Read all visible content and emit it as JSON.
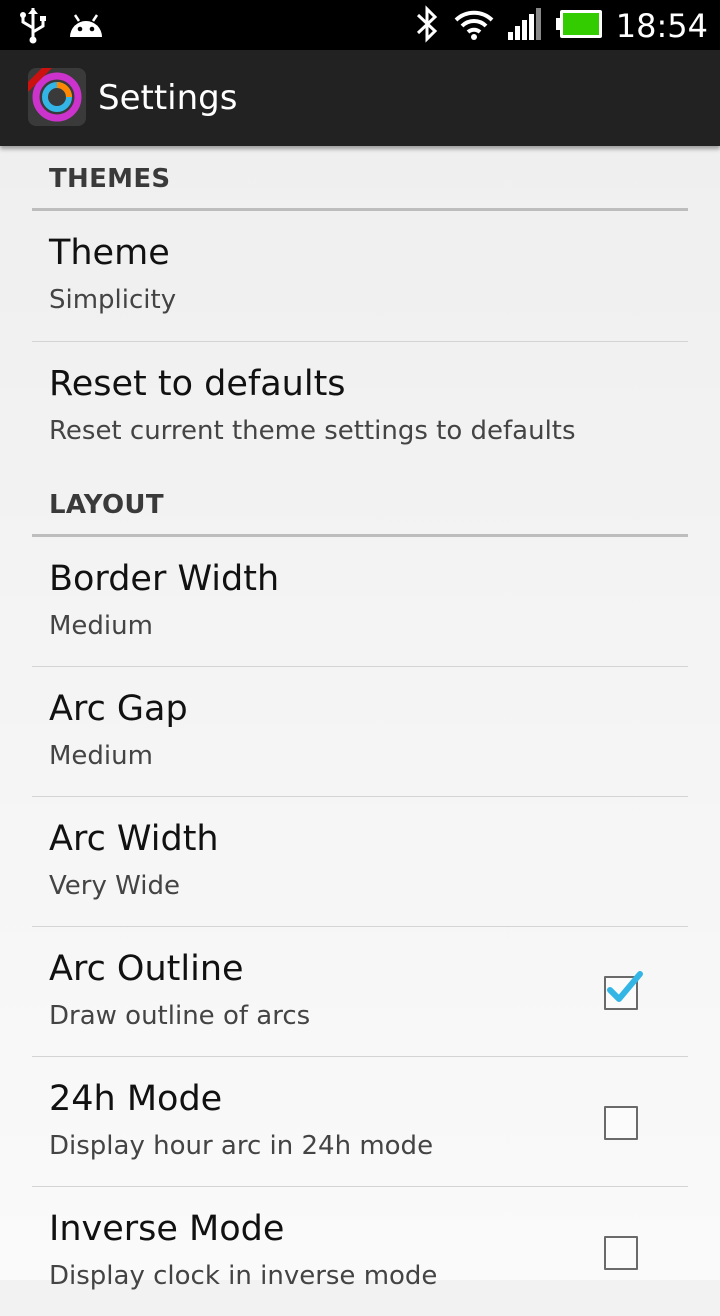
{
  "status_bar": {
    "time": "18:54",
    "icons_left": [
      "usb-icon",
      "android-debug-icon"
    ],
    "icons_right": [
      "bluetooth-icon",
      "wifi-icon",
      "signal-icon",
      "battery-icon"
    ]
  },
  "action_bar": {
    "title": "Settings",
    "app_icon": "app-icon"
  },
  "sections": {
    "themes": {
      "header": "THEMES",
      "items": [
        {
          "title": "Theme",
          "summary": "Simplicity"
        },
        {
          "title": "Reset to defaults",
          "summary": "Reset current theme settings to defaults"
        }
      ]
    },
    "layout": {
      "header": "LAYOUT",
      "items": [
        {
          "title": "Border Width",
          "summary": "Medium"
        },
        {
          "title": "Arc Gap",
          "summary": "Medium"
        },
        {
          "title": "Arc Width",
          "summary": "Very Wide"
        },
        {
          "title": "Arc Outline",
          "summary": "Draw outline of arcs",
          "checked": true
        },
        {
          "title": "24h Mode",
          "summary": "Display hour arc in 24h mode",
          "checked": false
        },
        {
          "title": "Inverse Mode",
          "summary": "Display clock in inverse mode",
          "checked": false
        }
      ]
    }
  },
  "colors": {
    "accent": "#33b5e5",
    "action_bar": "#222222",
    "status_bar": "#000000"
  }
}
